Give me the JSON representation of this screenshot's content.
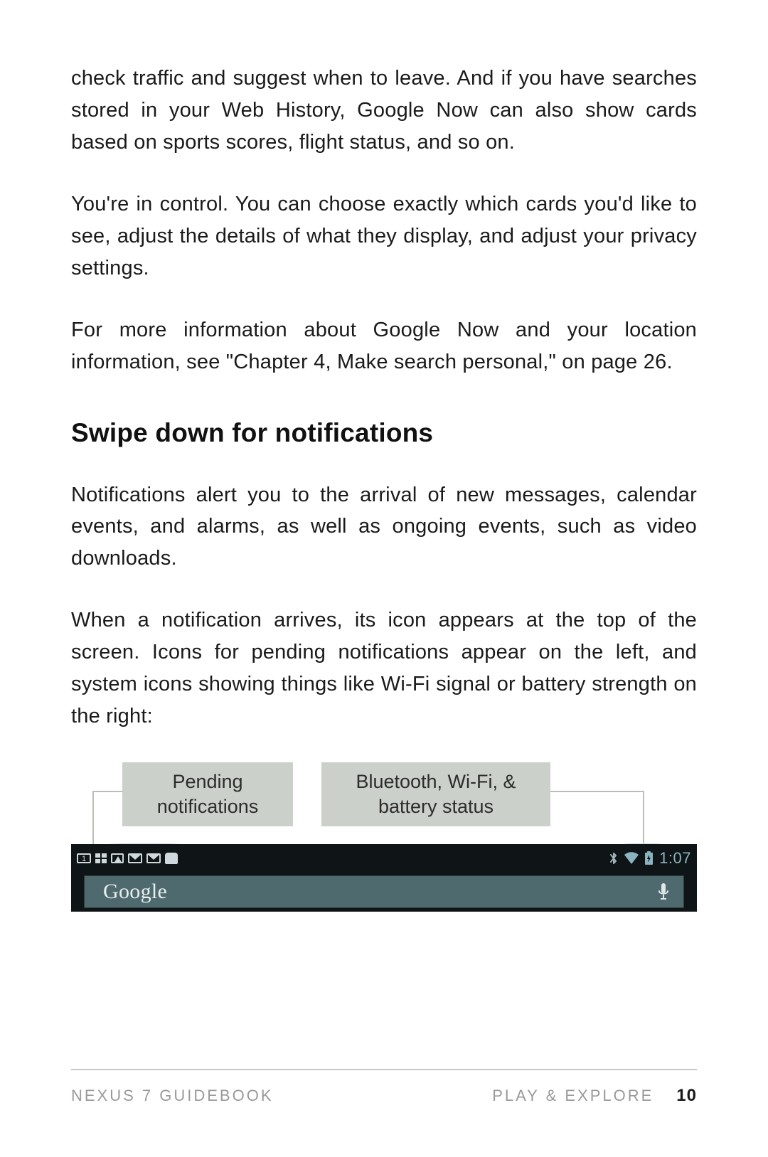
{
  "paragraphs": {
    "p1": "check traffic and suggest when to leave. And if you have searches stored in your Web History, Google Now can also show cards based on sports scores, flight status, and so on.",
    "p2": "You're in control. You can choose exactly which cards you'd like to see, adjust the details of what they display, and adjust your privacy settings.",
    "p3_lead": "For more information about Google Now and your location information, see ",
    "p3_xref": "\"Chapter 4, Make search personal,\" on page 26",
    "p3_tail": ".",
    "p4": "Notifications alert you to the arrival of new messages, calendar events, and alarms, as well as ongoing events, such as video downloads.",
    "p5": "When a notification arrives, its icon appears at the top of the screen. Icons for pending notifications appear on the left, and system icons showing things like Wi-Fi signal or battery strength on the right:"
  },
  "heading": "Swipe down for notifications",
  "figure": {
    "callout_left": "Pending notifications",
    "callout_right": "Bluetooth, Wi-Fi, & battery status",
    "status_left_icons": [
      "update-icon",
      "apps-grid-icon",
      "image-icon",
      "mail-icon",
      "mail-icon",
      "android-icon"
    ],
    "status_right_icons": [
      "bluetooth-icon",
      "wifi-icon",
      "battery-charging-icon"
    ],
    "clock": "1:07",
    "search_brand": "Google"
  },
  "footer": {
    "left": "NEXUS 7 GUIDEBOOK",
    "right": "PLAY & EXPLORE",
    "page": "10"
  }
}
